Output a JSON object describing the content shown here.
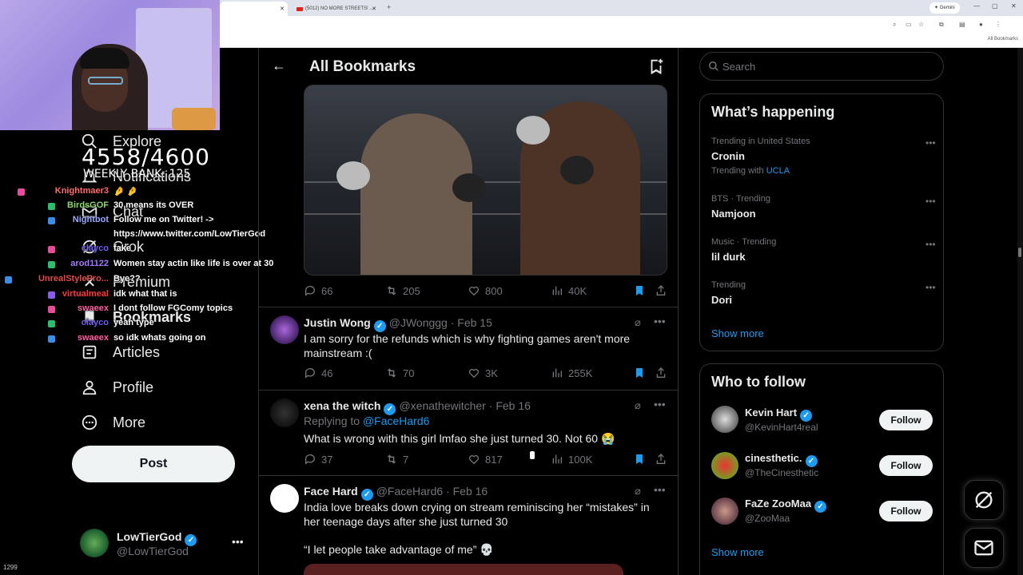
{
  "browser": {
    "tab_active": "",
    "tab_youtube": "(5012) NO MORE STREETS! ...",
    "gemini": "✦ Gemini",
    "bookmarks_label": "All Bookmarks",
    "new_tab": "+"
  },
  "stream": {
    "counter": "4558/4600",
    "weekly": "WEEKLY BANK: 125",
    "viewers": "1299",
    "chat": [
      {
        "user": "Knightmaer3",
        "color": "#ff6a6a",
        "msg": "🤌 🤌"
      },
      {
        "user": "BirdsGOF",
        "color": "#8dd66b",
        "msg": "30 means its OVER"
      },
      {
        "user": "Nightbot",
        "color": "#9aa8ff",
        "msg": "Follow me on Twitter! ->"
      },
      {
        "user": "",
        "color": "#ffffff",
        "msg": "https://www.twitter.com/LowTierGod"
      },
      {
        "user": "clayco",
        "color": "#6e5df2",
        "msg": "fake"
      },
      {
        "user": "arod1122",
        "color": "#a378ff",
        "msg": "Women stay actin like life is over at 30"
      },
      {
        "user": "UnrealStylePro...",
        "color": "#e24b4b",
        "msg": "Bye??"
      },
      {
        "user": "virtualmeal",
        "color": "#ff3b3b",
        "msg": "idk what that is"
      },
      {
        "user": "swaeex",
        "color": "#ff5fa2",
        "msg": "I dont follow FGComy topics"
      },
      {
        "user": "clayco",
        "color": "#6e5df2",
        "msg": "yeah type"
      },
      {
        "user": "swaeex",
        "color": "#ff5fa2",
        "msg": "so idk whats going on"
      }
    ]
  },
  "nav": {
    "items": [
      {
        "label": "Explore"
      },
      {
        "label": "Notifications"
      },
      {
        "label": "Chat"
      },
      {
        "label": "Grok"
      },
      {
        "label": "Premium"
      },
      {
        "label": "Bookmarks"
      },
      {
        "label": "Articles"
      },
      {
        "label": "Profile"
      },
      {
        "label": "More"
      }
    ],
    "post_label": "Post",
    "account": {
      "name": "LowTierGod",
      "handle": "@LowTierGod"
    }
  },
  "header": {
    "title": "All Bookmarks"
  },
  "tweets": [
    {
      "stats": {
        "replies": "66",
        "retweets": "205",
        "likes": "800",
        "views": "40K"
      }
    },
    {
      "name": "Justin Wong",
      "handle": "@JWonggg",
      "date": "Feb 15",
      "text": "I am sorry for the refunds which is why fighting games aren't more mainstream :(",
      "stats": {
        "replies": "46",
        "retweets": "70",
        "likes": "3K",
        "views": "255K"
      }
    },
    {
      "name": "xena the witch",
      "handle": "@xenathewitcher",
      "date": "Feb 16",
      "reply_prefix": "Replying to",
      "reply_to": "@FaceHard6",
      "text": "What is wrong with this girl lmfao she just turned 30. Not 60 😭",
      "stats": {
        "replies": "37",
        "retweets": "7",
        "likes": "817",
        "views": "100K"
      }
    },
    {
      "name": "Face Hard",
      "handle": "@FaceHard6",
      "date": "Feb 16",
      "text": "India love breaks down crying on stream reminiscing her “mistakes” in her teenage days after she just turned 30",
      "quote": "“I let people take advantage of me” 💀"
    }
  ],
  "right": {
    "search_placeholder": "Search",
    "trending_title": "What’s happening",
    "trends": [
      {
        "meta": "Trending in United States",
        "topic": "Cronin",
        "with_prefix": "Trending with",
        "with": "UCLA"
      },
      {
        "meta": "BTS · Trending",
        "topic": "Namjoon"
      },
      {
        "meta": "Music · Trending",
        "topic": "lil durk"
      },
      {
        "meta": "Trending",
        "topic": "Dori"
      }
    ],
    "show_more": "Show more",
    "wtf_title": "Who to follow",
    "wtf": [
      {
        "name": "Kevin Hart",
        "handle": "@KevinHart4real",
        "button": "Follow"
      },
      {
        "name": "cinesthetic.",
        "handle": "@TheCinesthetic",
        "button": "Follow"
      },
      {
        "name": "FaZe ZooMaa",
        "handle": "@ZooMaa",
        "button": "Follow"
      }
    ],
    "wtf_show_more": "Show more"
  },
  "colors": {
    "accent": "#1d9bf0",
    "background": "#000000",
    "border": "#2f3336",
    "muted": "#71767b"
  }
}
